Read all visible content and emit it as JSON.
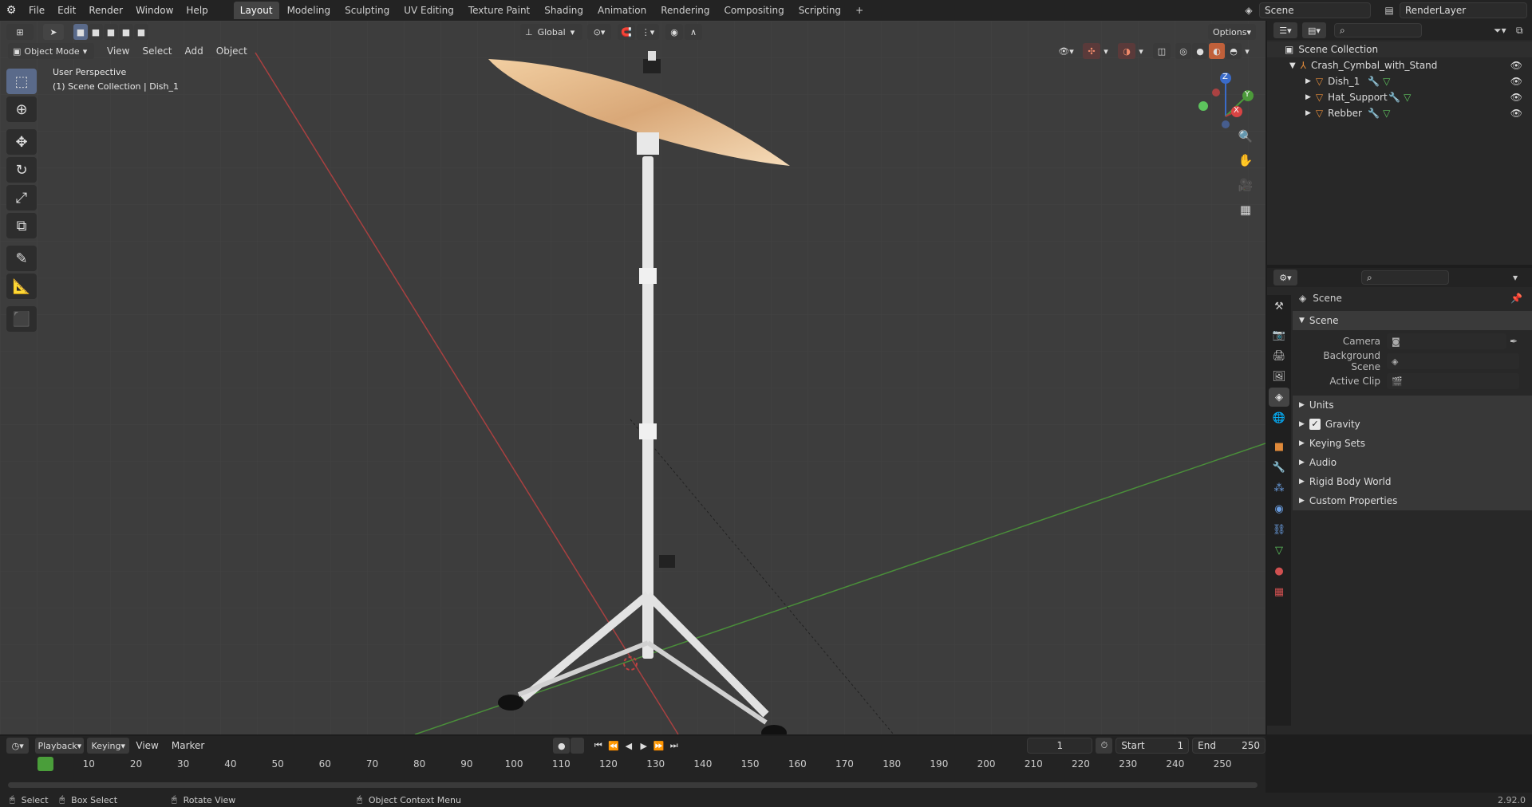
{
  "top_menu": [
    "File",
    "Edit",
    "Render",
    "Window",
    "Help"
  ],
  "workspaces": [
    "Layout",
    "Modeling",
    "Sculpting",
    "UV Editing",
    "Texture Paint",
    "Shading",
    "Animation",
    "Rendering",
    "Compositing",
    "Scripting"
  ],
  "active_workspace": "Layout",
  "add_workspace": "+",
  "scene_field": "Scene",
  "renderlayer_field": "RenderLayer",
  "viewport": {
    "mode": "Object Mode",
    "menus": [
      "View",
      "Select",
      "Add",
      "Object"
    ],
    "transform_orientation": "Global",
    "options_label": "Options",
    "overlay_title": "User Perspective",
    "overlay_subtitle": "(1) Scene Collection | Dish_1",
    "gizmo": {
      "z": "Z",
      "y": "Y",
      "x": "X"
    }
  },
  "outliner": {
    "root": "Scene Collection",
    "collection": "Crash_Cymbal_with_Stand",
    "objects": [
      "Dish_1",
      "Hat_Support",
      "Rebber"
    ]
  },
  "properties": {
    "breadcrumb": "Scene",
    "section_scene": "Scene",
    "fields": [
      {
        "label": "Camera",
        "value": ""
      },
      {
        "label": "Background Scene",
        "value": ""
      },
      {
        "label": "Active Clip",
        "value": ""
      }
    ],
    "collapsed_sections": [
      "Units",
      "Gravity",
      "Keying Sets",
      "Audio",
      "Rigid Body World",
      "Custom Properties"
    ],
    "gravity_checked": true
  },
  "timeline": {
    "menus": [
      "Playback",
      "Keying",
      "View",
      "Marker"
    ],
    "current_frame": "1",
    "start_label": "Start",
    "start_value": "1",
    "end_label": "End",
    "end_value": "250",
    "ticks": [
      "1",
      "10",
      "20",
      "30",
      "40",
      "50",
      "60",
      "70",
      "80",
      "90",
      "100",
      "110",
      "120",
      "130",
      "140",
      "150",
      "160",
      "170",
      "180",
      "190",
      "200",
      "210",
      "220",
      "230",
      "240",
      "250"
    ]
  },
  "statusbar": {
    "select": "Select",
    "box_select": "Box Select",
    "rotate_view": "Rotate View",
    "context_menu": "Object Context Menu",
    "version": "2.92.0"
  },
  "colors": {
    "accent": "#e07a2a",
    "active_frame": "#4a9e3a",
    "x_axis": "#b33a3a",
    "y_axis": "#4c9a3a",
    "z_axis": "#3a6bc9"
  }
}
